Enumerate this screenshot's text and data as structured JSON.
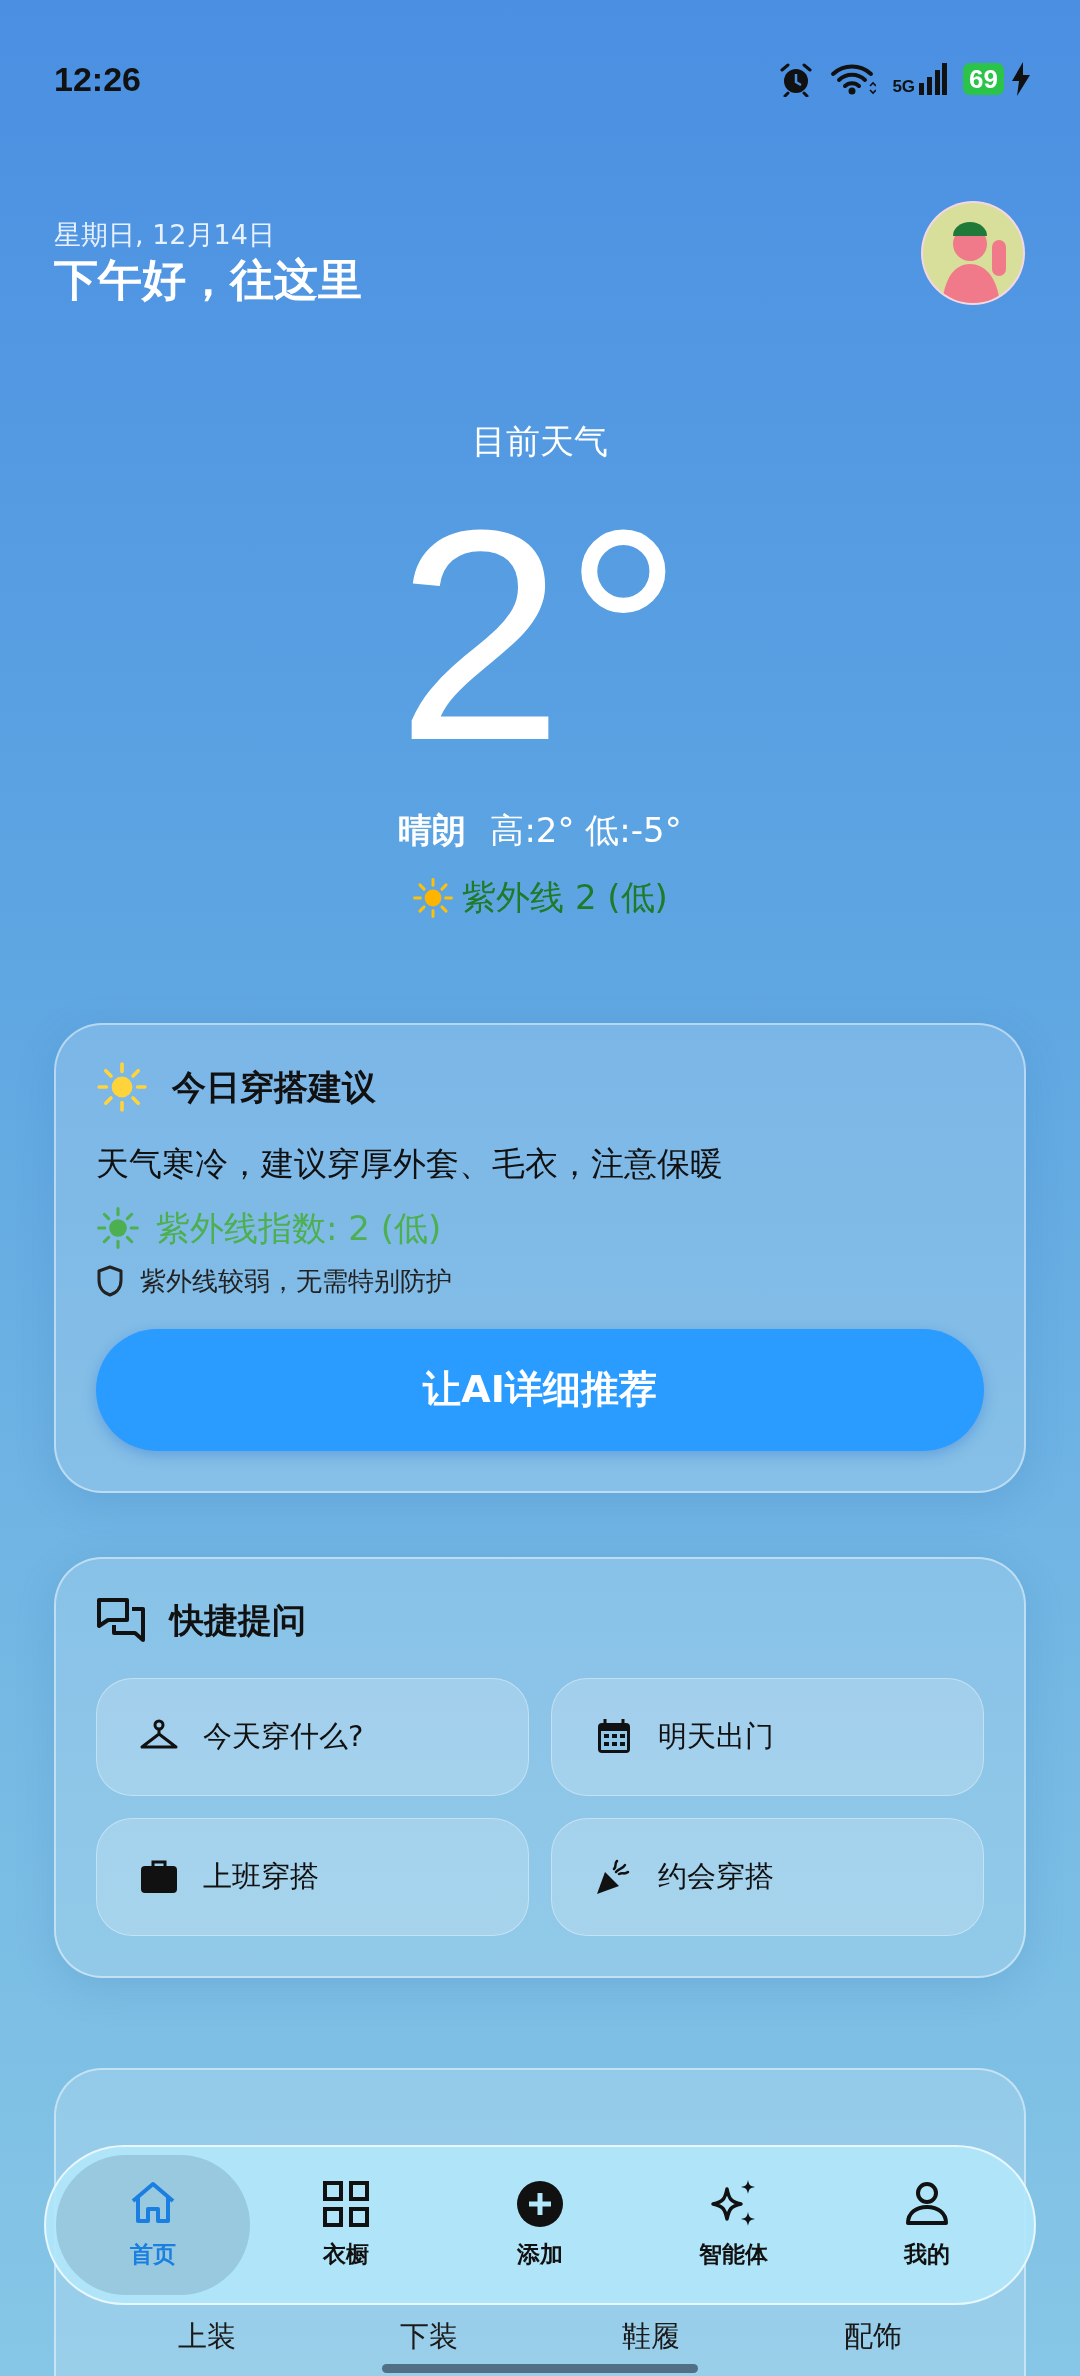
{
  "status_bar": {
    "time": "12:26",
    "network": "5G",
    "battery": "69",
    "charging": true
  },
  "header": {
    "date": "星期日, 12月14日",
    "greeting": "下午好，往这里"
  },
  "weather": {
    "label": "目前天气",
    "temperature": "2°",
    "condition": "晴朗",
    "high_low": "高:2° 低:-5°",
    "uv": "紫外线 2 (低)"
  },
  "outfit_card": {
    "title": "今日穿搭建议",
    "advice": "天气寒冷，建议穿厚外套、毛衣，注意保暖",
    "uv_index": "紫外线指数: 2 (低)",
    "uv_note": "紫外线较弱，无需特别防护",
    "button": "让AI详细推荐"
  },
  "quick_questions": {
    "title": "快捷提问",
    "items": [
      {
        "label": "今天穿什么?",
        "kind": "hanger"
      },
      {
        "label": "明天出门",
        "kind": "calendar"
      },
      {
        "label": "上班穿搭",
        "kind": "briefcase"
      },
      {
        "label": "约会穿搭",
        "kind": "party"
      }
    ]
  },
  "stats_card": {
    "categories": [
      "上装",
      "下装",
      "鞋履",
      "配饰"
    ]
  },
  "tab_bar": [
    {
      "label": "首页",
      "kind": "home",
      "selected": true
    },
    {
      "label": "衣橱",
      "kind": "grid",
      "selected": false
    },
    {
      "label": "添加",
      "kind": "add",
      "selected": false
    },
    {
      "label": "智能体",
      "kind": "sparkle",
      "selected": false
    },
    {
      "label": "我的",
      "kind": "person",
      "selected": false
    }
  ]
}
